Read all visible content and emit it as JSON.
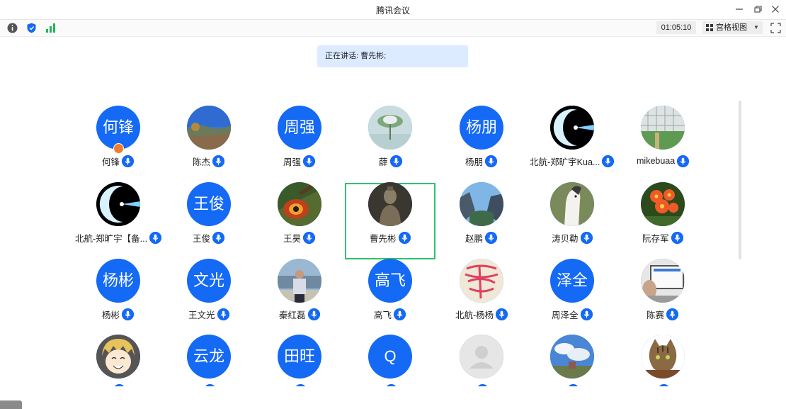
{
  "window": {
    "title": "腾讯会议"
  },
  "toolbar": {
    "timer": "01:05:10",
    "view_mode": "宫格视图"
  },
  "speaking": {
    "text": "正在讲话: 曹先彬;"
  },
  "colors": {
    "accent": "#1469f5",
    "active_border": "#2ec26e",
    "host_badge": "#f07c2c"
  },
  "participants": [
    {
      "name": "何锋",
      "avatar_text": "何锋",
      "avatar_type": "text",
      "host": true
    },
    {
      "name": "陈杰",
      "avatar_type": "photo-landscape"
    },
    {
      "name": "周强",
      "avatar_text": "周强",
      "avatar_type": "text"
    },
    {
      "name": "薛",
      "avatar_type": "photo-lotus"
    },
    {
      "name": "杨朋",
      "avatar_text": "杨朋",
      "avatar_type": "text"
    },
    {
      "name": "北航-郑旷宇Kua...",
      "avatar_type": "photo-crescent"
    },
    {
      "name": "mikebuaa",
      "avatar_type": "photo-greenhouse"
    },
    {
      "name": "北航-郑旷宇【备...",
      "avatar_type": "photo-crescent"
    },
    {
      "name": "王俊",
      "avatar_text": "王俊",
      "avatar_type": "text"
    },
    {
      "name": "王昊",
      "avatar_type": "photo-guitar"
    },
    {
      "name": "曹先彬",
      "avatar_type": "photo-statue",
      "active": true
    },
    {
      "name": "赵鹏",
      "avatar_type": "photo-valley"
    },
    {
      "name": "涛贝勒",
      "avatar_type": "photo-horse"
    },
    {
      "name": "阮存军",
      "avatar_type": "photo-flower"
    },
    {
      "name": "杨彬",
      "avatar_text": "杨彬",
      "avatar_type": "text"
    },
    {
      "name": "王文光",
      "avatar_text": "文光",
      "avatar_type": "text"
    },
    {
      "name": "秦红磊",
      "avatar_type": "photo-person"
    },
    {
      "name": "高飞",
      "avatar_text": "高飞",
      "avatar_type": "text"
    },
    {
      "name": "北航-杨杨",
      "avatar_type": "photo-scribble"
    },
    {
      "name": "周泽全",
      "avatar_text": "泽全",
      "avatar_type": "text"
    },
    {
      "name": "陈赛",
      "avatar_type": "photo-monitor"
    },
    {
      "name": "",
      "avatar_type": "photo-anime"
    },
    {
      "name": "",
      "avatar_text": "云龙",
      "avatar_type": "text"
    },
    {
      "name": "",
      "avatar_text": "田旺",
      "avatar_type": "text"
    },
    {
      "name": "",
      "avatar_text": "Q",
      "avatar_type": "text"
    },
    {
      "name": "",
      "avatar_type": "default"
    },
    {
      "name": "",
      "avatar_type": "photo-sky"
    },
    {
      "name": "",
      "avatar_type": "photo-cat"
    }
  ]
}
